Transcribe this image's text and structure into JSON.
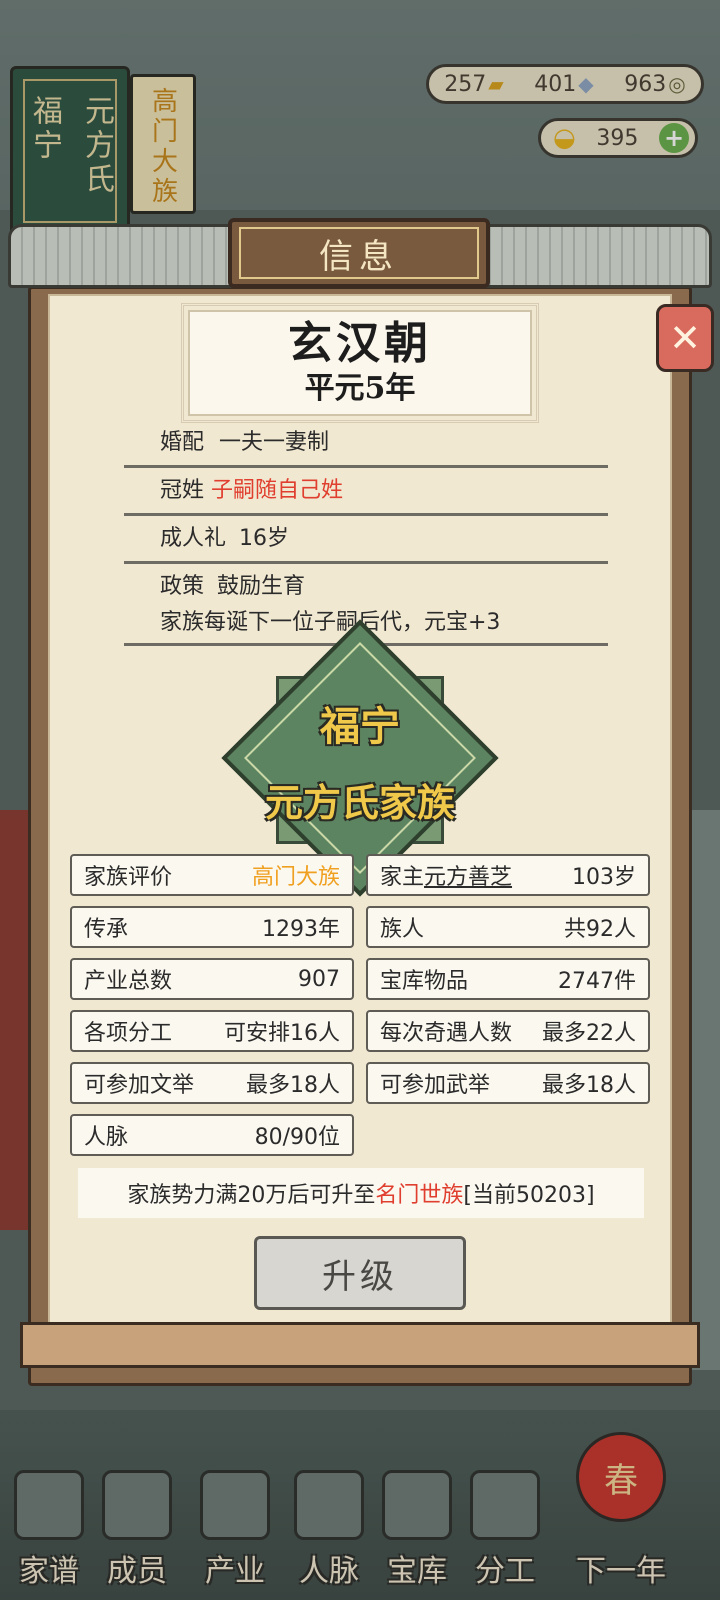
{
  "top": {
    "family_book": {
      "place": "福宁",
      "clan": "元方氏"
    },
    "rank_book": "高门大族",
    "resources": [
      {
        "value": "257",
        "icon": "gold-bar-icon"
      },
      {
        "value": "401",
        "icon": "silver-ingot-icon"
      },
      {
        "value": "963",
        "icon": "copper-coin-icon"
      }
    ],
    "gold_ingot": {
      "value": "395",
      "icon": "yuanbao-icon"
    }
  },
  "modal": {
    "title": "信息",
    "close_glyph": "✕",
    "dynasty": {
      "name": "玄汉朝",
      "year": "平元5年"
    },
    "rules": {
      "marriage_label": "婚配",
      "marriage_value": "一夫一妻制",
      "surname_label": "冠姓",
      "surname_value": "子嗣随自己姓",
      "coming_of_age_label": "成人礼",
      "coming_of_age_value": "16岁",
      "policy_label": "政策",
      "policy_value": "鼓励生育",
      "policy_desc": "家族每诞下一位子嗣后代，元宝+3"
    },
    "emblem": {
      "place": "福宁",
      "clan": "元方氏家族"
    },
    "stats": {
      "rating_label": "家族评价",
      "rating_value": "高门大族",
      "head_label": "家主",
      "head_name": "元方善芝",
      "head_age": "103岁",
      "heritage_label": "传承",
      "heritage_value": "1293年",
      "members_label": "族人",
      "members_value": "共92人",
      "industry_label": "产业总数",
      "industry_value": "907",
      "treasury_label": "宝库物品",
      "treasury_value": "2747件",
      "division_label": "各项分工",
      "division_value": "可安排16人",
      "adventure_label": "每次奇遇人数",
      "adventure_value": "最多22人",
      "civil_exam_label": "可参加文举",
      "civil_exam_value": "最多18人",
      "military_exam_label": "可参加武举",
      "military_exam_value": "最多18人",
      "network_label": "人脉",
      "network_value": "80/90位"
    },
    "upgrade_note": {
      "prefix": "家族势力满20万后可升至",
      "target": "名门世族",
      "suffix": "[当前50203]"
    },
    "upgrade_button": "升级"
  },
  "bottom_nav": [
    "家谱",
    "成员",
    "产业",
    "人脉",
    "宝库",
    "分工",
    "下一年"
  ],
  "lantern_char": "春",
  "colors": {
    "accent_red": "#e03e2e",
    "accent_orange": "#f0a020",
    "emblem_green": "#5d8460",
    "emblem_gold": "#f0c84a"
  }
}
